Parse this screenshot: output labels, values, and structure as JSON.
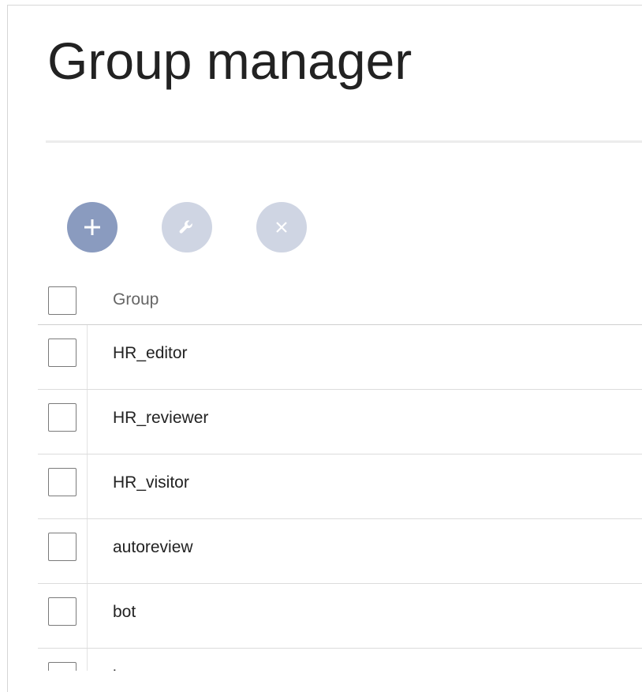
{
  "page": {
    "title": "Group manager"
  },
  "toolbar": {
    "add_icon": "plus-icon",
    "edit_icon": "wrench-icon",
    "delete_icon": "close-icon",
    "colors": {
      "active": "#8a9bbf",
      "disabled": "#cfd5e3"
    }
  },
  "table": {
    "column_header": "Group",
    "rows": [
      {
        "group": "HR_editor"
      },
      {
        "group": "HR_reviewer"
      },
      {
        "group": "HR_visitor"
      },
      {
        "group": "autoreview"
      },
      {
        "group": "bot"
      },
      {
        "group": "bureaucrat"
      }
    ]
  }
}
